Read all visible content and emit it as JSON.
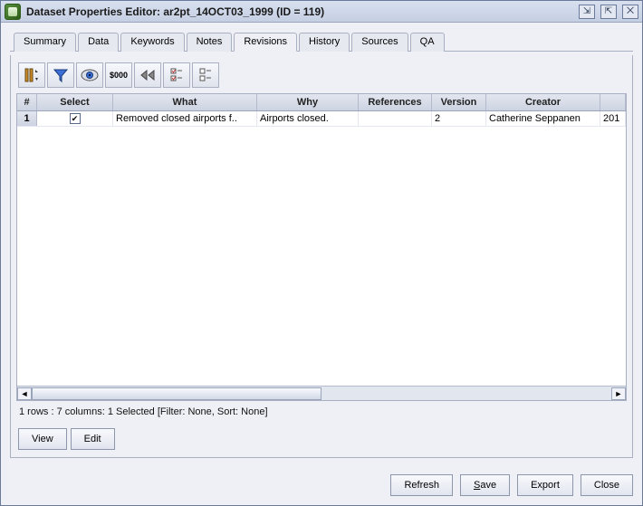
{
  "window": {
    "title": "Dataset Properties Editor: ar2pt_14OCT03_1999 (ID = 119)"
  },
  "tabs": [
    "Summary",
    "Data",
    "Keywords",
    "Notes",
    "Revisions",
    "History",
    "Sources",
    "QA"
  ],
  "active_tab": "Revisions",
  "toolbar_icons": [
    "sort-columns-icon",
    "filter-icon",
    "eye-icon",
    "currency-icon",
    "rewind-icon",
    "checklist-a-icon",
    "checklist-b-icon"
  ],
  "table": {
    "columns": [
      "#",
      "Select",
      "What",
      "Why",
      "References",
      "Version",
      "Creator",
      ""
    ],
    "rows": [
      {
        "n": "1",
        "select": true,
        "what": "Removed closed airports f..",
        "why": "Airports closed.",
        "references": "",
        "version": "2",
        "creator": "Catherine Seppanen",
        "date": "201"
      }
    ]
  },
  "status": "1 rows : 7 columns: 1 Selected [Filter: None, Sort: None]",
  "panel_buttons": {
    "view": "View",
    "edit": "Edit"
  },
  "footer_buttons": {
    "refresh": "Refresh",
    "save": "Save",
    "export": "Export",
    "close": "Close"
  }
}
